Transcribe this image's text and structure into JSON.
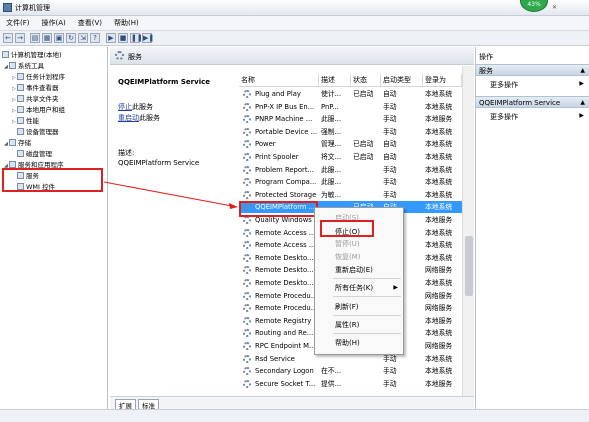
{
  "window": {
    "title": "计算机管理",
    "gauge_text": "43%"
  },
  "menu": [
    "文件(F)",
    "操作(A)",
    "查看(V)",
    "帮助(H)"
  ],
  "toolbar_icons": [
    "back-arrow-icon",
    "forward-arrow-icon",
    "up-folder-icon",
    "show-hide-tree-icon",
    "properties-icon",
    "refresh-icon",
    "export-icon",
    "help-icon",
    "start-icon",
    "stop-icon",
    "pause-icon",
    "restart-icon"
  ],
  "tree": [
    {
      "label": "计算机管理(本地)"
    },
    {
      "label": "系统工具"
    },
    {
      "label": "任务计划程序"
    },
    {
      "label": "事件查看器"
    },
    {
      "label": "共享文件夹"
    },
    {
      "label": "本地用户和组"
    },
    {
      "label": "性能"
    },
    {
      "label": "设备管理器"
    },
    {
      "label": "存储"
    },
    {
      "label": "磁盘管理"
    },
    {
      "label": "服务和应用程序"
    },
    {
      "label": "服务"
    },
    {
      "label": "WMI 控件"
    }
  ],
  "services_header": "服务",
  "detail": {
    "title": "QQEIMPlatform Service",
    "stop_link": "停止",
    "stop_suffix": "此服务",
    "restart_link": "重启动",
    "restart_suffix": "此服务",
    "desc_label": "描述:",
    "desc_value": "QQEIMPlatform Service"
  },
  "columns": [
    "名称",
    "描述",
    "状态",
    "启动类型",
    "登录为"
  ],
  "rows": [
    {
      "name": "Plug and Play",
      "desc": "使计...",
      "status": "已启动",
      "startup": "自动",
      "logon": "本地系统"
    },
    {
      "name": "PnP-X IP Bus En...",
      "desc": "PnP...",
      "status": "",
      "startup": "手动",
      "logon": "本地系统"
    },
    {
      "name": "PNRP Machine ...",
      "desc": "此服...",
      "status": "",
      "startup": "手动",
      "logon": "本地服务"
    },
    {
      "name": "Portable Device ...",
      "desc": "强制...",
      "status": "",
      "startup": "手动",
      "logon": "本地系统"
    },
    {
      "name": "Power",
      "desc": "管理...",
      "status": "已启动",
      "startup": "自动",
      "logon": "本地系统"
    },
    {
      "name": "Print Spooler",
      "desc": "将文...",
      "status": "已启动",
      "startup": "自动",
      "logon": "本地系统"
    },
    {
      "name": "Problem Report...",
      "desc": "此服...",
      "status": "",
      "startup": "手动",
      "logon": "本地系统"
    },
    {
      "name": "Program Compa...",
      "desc": "此服...",
      "status": "",
      "startup": "手动",
      "logon": "本地系统"
    },
    {
      "name": "Protected Storage",
      "desc": "为敏...",
      "status": "",
      "startup": "手动",
      "logon": "本地系统"
    },
    {
      "name": "QQEIMPlatform ...",
      "desc": "",
      "status": "已启动",
      "startup": "自动",
      "logon": "本地系统",
      "selected": true
    },
    {
      "name": "Quality Windows ...",
      "desc": "",
      "status": "",
      "startup": "手动",
      "logon": "本地服务"
    },
    {
      "name": "Remote Access ...",
      "desc": "",
      "status": "",
      "startup": "手动",
      "logon": "本地系统"
    },
    {
      "name": "Remote Access ...",
      "desc": "",
      "status": "",
      "startup": "手动",
      "logon": "本地系统"
    },
    {
      "name": "Remote Deskto...",
      "desc": "",
      "status": "",
      "startup": "手动",
      "logon": "本地系统"
    },
    {
      "name": "Remote Deskto...",
      "desc": "",
      "status": "",
      "startup": "手动",
      "logon": "网络服务"
    },
    {
      "name": "Remote Deskto...",
      "desc": "",
      "status": "",
      "startup": "手动",
      "logon": "本地系统"
    },
    {
      "name": "Remote Procedu...",
      "desc": "",
      "status": "",
      "startup": "自动",
      "logon": "网络服务"
    },
    {
      "name": "Remote Procedu...",
      "desc": "",
      "status": "",
      "startup": "手动",
      "logon": "网络服务"
    },
    {
      "name": "Remote Registry",
      "desc": "",
      "status": "",
      "startup": "手动",
      "logon": "本地服务"
    },
    {
      "name": "Routing and Re...",
      "desc": "",
      "status": "",
      "startup": "禁用",
      "logon": "本地系统"
    },
    {
      "name": "RPC Endpoint M...",
      "desc": "",
      "status": "",
      "startup": "自动",
      "logon": "网络服务"
    },
    {
      "name": "Rsd Service",
      "desc": "",
      "status": "",
      "startup": "手动",
      "logon": "本地系统"
    },
    {
      "name": "Secondary Logon",
      "desc": "在不...",
      "status": "",
      "startup": "手动",
      "logon": "本地系统"
    },
    {
      "name": "Secure Socket T...",
      "desc": "提供...",
      "status": "",
      "startup": "手动",
      "logon": "本地服务"
    }
  ],
  "context_menu": [
    {
      "label": "启动(S)",
      "disabled": true
    },
    {
      "label": "停止(O)",
      "disabled": false
    },
    {
      "label": "暂停(U)",
      "disabled": true
    },
    {
      "label": "恢复(M)",
      "disabled": true
    },
    {
      "label": "重新启动(E)",
      "disabled": false
    },
    {
      "label": "所有任务(K)",
      "disabled": false,
      "submenu": true
    },
    {
      "label": "刷新(F)",
      "disabled": false
    },
    {
      "label": "属性(R)",
      "disabled": false
    },
    {
      "label": "帮助(H)",
      "disabled": false
    }
  ],
  "actions": {
    "header": "操作",
    "group1": "服务",
    "group1_item": "更多操作",
    "group2": "QQEIMPlatform Service",
    "group2_item": "更多操作"
  },
  "tabs": [
    "扩展",
    "标准"
  ],
  "colors": {
    "selection": "#3399ff",
    "highlight_box": "#e02020"
  }
}
